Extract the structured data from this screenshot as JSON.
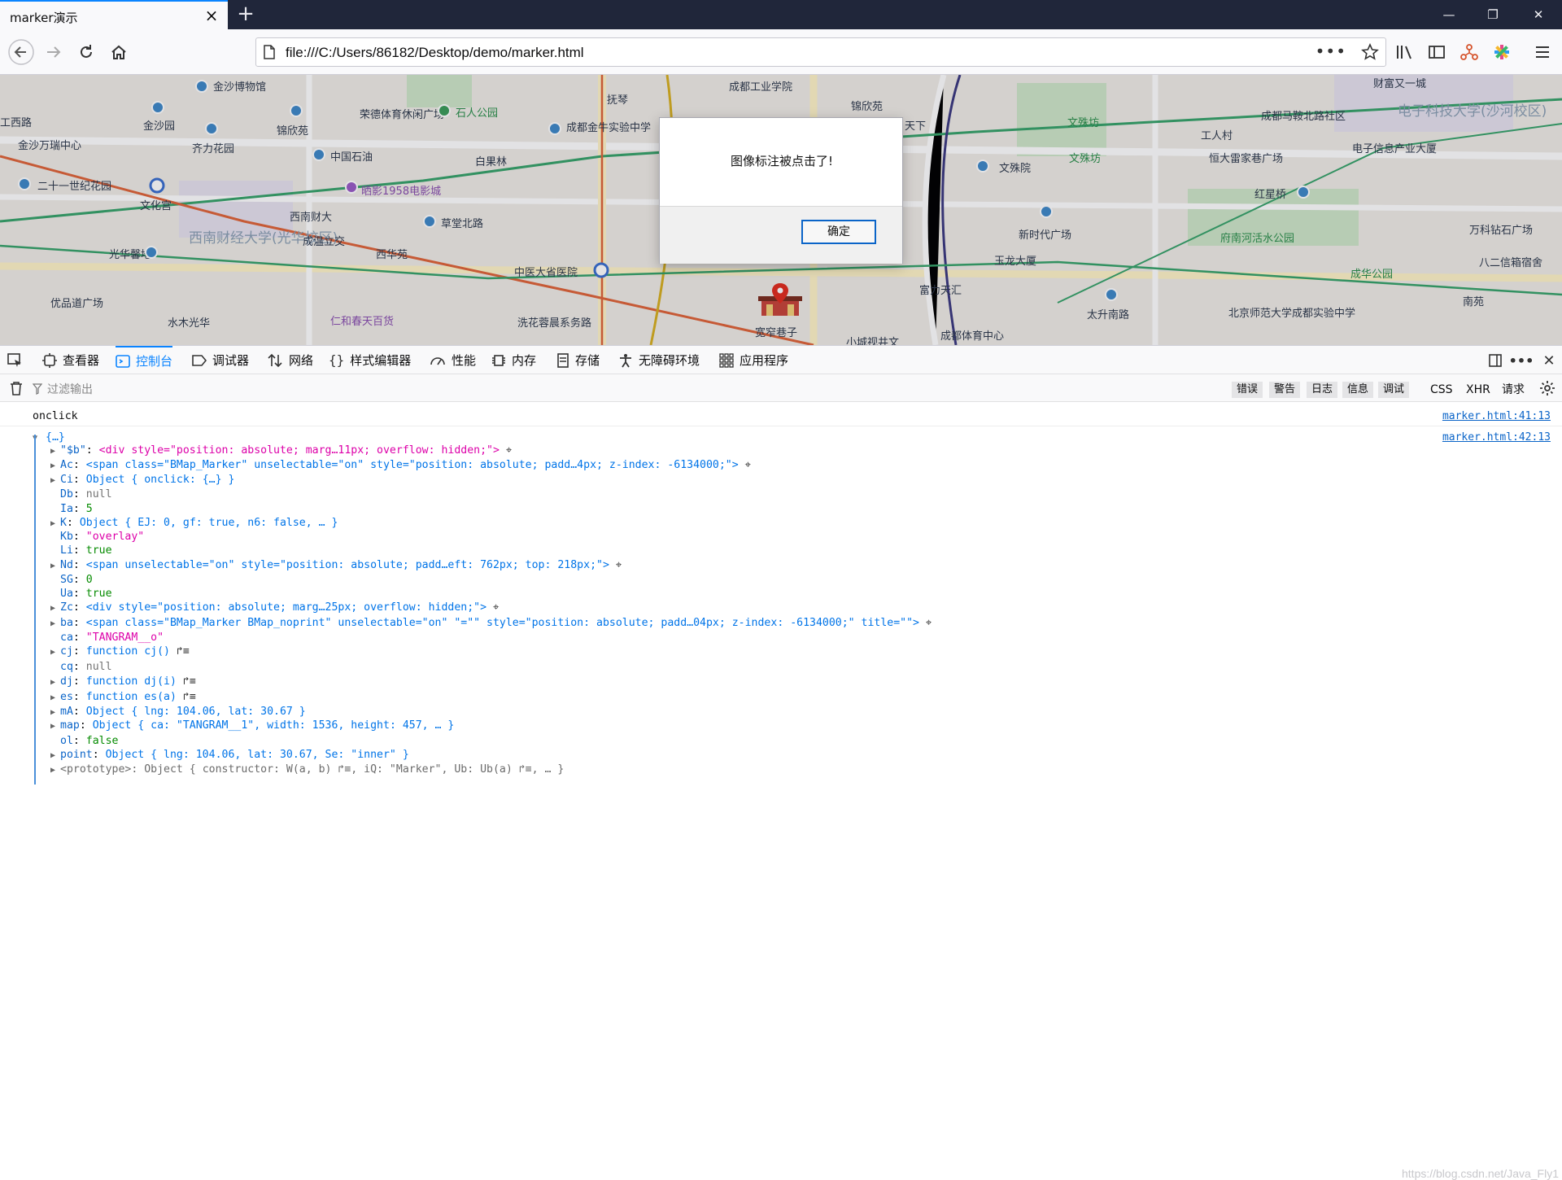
{
  "browser": {
    "tab_title": "marker演示",
    "url": "file:///C:/Users/86182/Desktop/demo/marker.html"
  },
  "map_labels": {
    "l01": "金沙博物馆",
    "l02": "金沙园",
    "l03": "金沙万瑞中心",
    "l04": "二十一世纪花园",
    "l05": "文化宫",
    "l06": "齐力花园",
    "l07": "锦欣苑",
    "l08": "中国石油",
    "l09": "荣德体育休闲广场",
    "l10": "石人公园",
    "l11": "晒影1958电影城",
    "l12": "西南财大",
    "l13": "草堂北路",
    "l14": "成温立交",
    "l15": "西华苑",
    "l16": "光华馨地",
    "l17": "优品道广场",
    "l18": "水木光华",
    "l19": "仁和春天百货",
    "l20": "洗花蓉晨系务路",
    "l21": "中医大省医院",
    "l22": "抚琴",
    "l23": "白果林",
    "l24": "成都金牛实验中学",
    "l25": "成都工业学院",
    "l26": "锦欣苑",
    "l27": "宽窄巷子",
    "l28": "天下",
    "l29": "文殊院",
    "l30": "文殊坊",
    "l31": "新时代广场",
    "l32": "玉龙大厦",
    "l33": "富力天汇",
    "l34": "成都体育中心",
    "l35": "太升南路",
    "l36": "北京师范大学成都实验中学",
    "l37": "工人村",
    "l38": "成都马鞍北路社区",
    "l39": "恒大雷家巷广场",
    "l40": "红星桥",
    "l41": "府南河活水公园",
    "l42": "成华公园",
    "l43": "电子科技大学(沙河校区)",
    "l44": "电子信息产业大厦",
    "l45": "万科钻石广场",
    "l46": "八二信箱宿舍",
    "l47": "南苑",
    "l48": "西南财经大学(光华校区)",
    "l49": "财富又一城",
    "l50": "工西路",
    "l51": "小城视井文"
  },
  "dialog": {
    "message": "图像标注被点击了!",
    "ok_label": "确定"
  },
  "devtools": {
    "tabs": [
      "查看器",
      "控制台",
      "调试器",
      "网络",
      "样式编辑器",
      "性能",
      "内存",
      "存储",
      "无障碍环境",
      "应用程序"
    ],
    "filter_placeholder": "过滤输出",
    "filters": [
      "错误",
      "警告",
      "日志",
      "信息",
      "调试"
    ],
    "extra_filters": [
      "CSS",
      "XHR",
      "请求"
    ]
  },
  "console": {
    "msg1": {
      "text": "onclick",
      "loc": "marker.html:41:13"
    },
    "msg2": {
      "text": "{…}",
      "loc": "marker.html:42:13"
    },
    "lines": {
      "p01_key": "\"$b\"",
      "p01_val": "<div style=\"position: absolute; marg…11px; overflow: hidden;\">",
      "p02_key": "Ac",
      "p02_val": "<span class=\"BMap_Marker\" unselectable=\"on\" style=\"position: absolute; padd…4px; z-index: -6134000;\">",
      "p03_key": "Ci",
      "p03_val": "Object { onclick: {…} }",
      "p04_key": "Db",
      "p04_val": "null",
      "p05_key": "Ia",
      "p05_val": "5",
      "p06_key": "K",
      "p06_val": "Object { EJ: 0, gf: true, n6: false, … }",
      "p07_key": "Kb",
      "p07_val": "\"overlay\"",
      "p08_key": "Li",
      "p08_val": "true",
      "p09_key": "Nd",
      "p09_val": "<span unselectable=\"on\" style=\"position: absolute; padd…eft: 762px; top: 218px;\">",
      "p10_key": "SG",
      "p10_val": "0",
      "p11_key": "Ua",
      "p11_val": "true",
      "p12_key": "Zc",
      "p12_val": "<div style=\"position: absolute; marg…25px; overflow: hidden;\">",
      "p13_key": "ba",
      "p13_val": "<span class=\"BMap_Marker BMap_noprint\" unselectable=\"on\" \"=\"\" style=\"position: absolute; padd…04px; z-index: -6134000;\" title=\"\">",
      "p14_key": "ca",
      "p14_val": "\"TANGRAM__o\"",
      "p15_key": "cj",
      "p15_val": "function cj()",
      "p16_key": "cq",
      "p16_val": "null",
      "p17_key": "dj",
      "p17_val": "function dj(i)",
      "p18_key": "es",
      "p18_val": "function es(a)",
      "p19_key": "mA",
      "p19_val": "Object { lng: 104.06, lat: 30.67 }",
      "p20_key": "map",
      "p20_val": "Object { ca: \"TANGRAM__1\", width: 1536, height: 457, … }",
      "p21_key": "ol",
      "p21_val": "false",
      "p22_key": "point",
      "p22_val": "Object { lng: 104.06, lat: 30.67, Se: \"inner\" }",
      "p23_key": "<prototype>",
      "p23_val": "Object { constructor: W(a, b) ↱≡, iQ: \"Marker\", Ub: Ub(a) ↱≡, … }"
    }
  },
  "watermark": "https://blog.csdn.net/Java_Fly1"
}
